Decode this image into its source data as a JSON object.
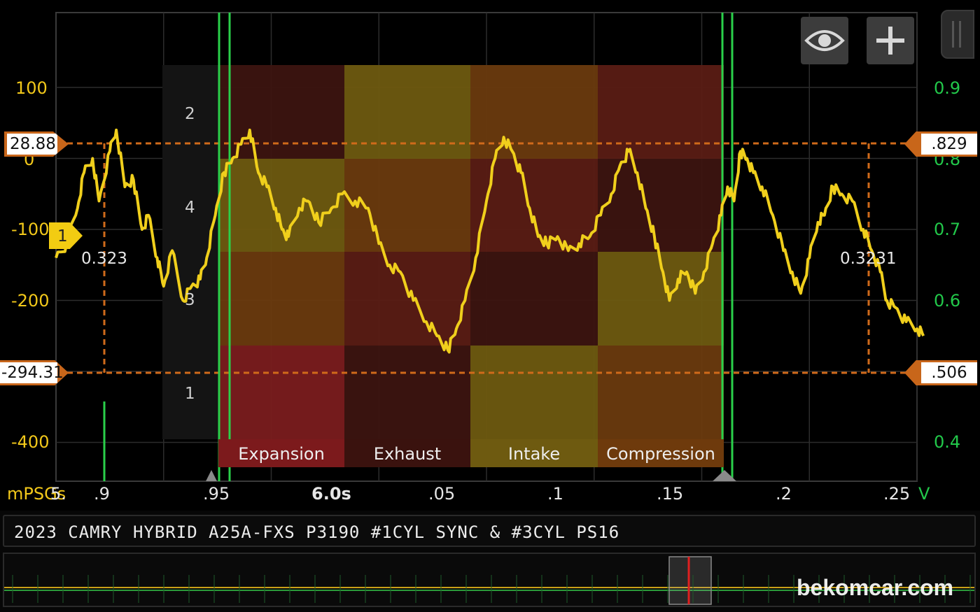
{
  "left_axis": {
    "unit": "mPSGs",
    "ticks": [
      {
        "label": "100",
        "value": 100
      },
      {
        "label": "0",
        "value": 0
      },
      {
        "label": "-100",
        "value": -100
      },
      {
        "label": "-200",
        "value": -200
      },
      {
        "label": "-400",
        "value": -400
      }
    ]
  },
  "right_axis": {
    "unit": "V",
    "ticks": [
      {
        "label": "0.9",
        "value": 0.9
      },
      {
        "label": "0.8",
        "value": 0.8
      },
      {
        "label": "0.7",
        "value": 0.7
      },
      {
        "label": "0.6",
        "value": 0.6
      },
      {
        "label": "0.4",
        "value": 0.4
      }
    ]
  },
  "x_axis": {
    "ticks": [
      {
        "label": "5.",
        "value": 5.85
      },
      {
        "label": ".9",
        "value": 5.9
      },
      {
        "label": ".95",
        "value": 5.95
      },
      {
        "label": "6.0s",
        "value": 6.0
      },
      {
        "label": ".05",
        "value": 6.05
      },
      {
        "label": ".1",
        "value": 6.1
      },
      {
        "label": ".15",
        "value": 6.15
      },
      {
        "label": ".2",
        "value": 6.2
      },
      {
        "label": ".25",
        "value": 6.25
      }
    ]
  },
  "cursors": {
    "left_upper": "28.88",
    "left_lower": "-294.31",
    "right_upper": ".829",
    "right_lower": ".506",
    "period_left": "0.323",
    "period_right": "0.3231"
  },
  "channel_marker": "1",
  "cylinder_labels": [
    "2",
    "4",
    "3",
    "1"
  ],
  "strokes": [
    "Expansion",
    "Exhaust",
    "Intake",
    "Compression"
  ],
  "colors": {
    "trace": "#f0cf1c",
    "sync": "#2ad04a",
    "cursor": "#d06a1a",
    "stroke_red": "#7c1a1c",
    "stroke_darkred": "#3a120e",
    "stroke_olive": "#6e5a10",
    "stroke_orange": "#6e3a0c"
  },
  "toolbar": {
    "view_icon": "eye-icon",
    "add_icon": "plus-icon"
  },
  "title": "2023 CAMRY HYBRID A25A-FXS P3190 #1CYL SYNC & #3CYL PS16",
  "watermark": "bekomcar.com",
  "chart_data": {
    "type": "line",
    "x_range": [
      5.85,
      6.25
    ],
    "ylim_left": [
      -480,
      150
    ],
    "ylim_right": [
      0.32,
      0.95
    ],
    "series": [
      {
        "axis": "right",
        "x": [
          5.85,
          5.855,
          5.86,
          5.863,
          5.867,
          5.87,
          5.875,
          5.878,
          5.882,
          5.886,
          5.89,
          5.893,
          5.897,
          5.9,
          5.904,
          5.909,
          5.913,
          5.917,
          5.92,
          5.924,
          5.928,
          5.932,
          5.936,
          5.94,
          5.944,
          5.948,
          5.952,
          5.955,
          5.958,
          5.963,
          5.967,
          5.972,
          5.978,
          5.983,
          5.989,
          5.995,
          6.0,
          6.005,
          6.01,
          6.016,
          6.022,
          6.027,
          6.032,
          6.036,
          6.04,
          6.045,
          6.05,
          6.054,
          6.058,
          6.062,
          6.066,
          6.07,
          6.074,
          6.078,
          6.083,
          6.088,
          6.093,
          6.098,
          6.103,
          6.108,
          6.112,
          6.116,
          6.12,
          6.124,
          6.128,
          6.132,
          6.135,
          6.139,
          6.143,
          6.147,
          6.151,
          6.155,
          6.159,
          6.162,
          6.165,
          6.168,
          6.171,
          6.174,
          6.178,
          6.183,
          6.188,
          6.192,
          6.196,
          6.2,
          6.204,
          6.207,
          6.211,
          6.215,
          6.22,
          6.225,
          6.229,
          6.233,
          6.236,
          6.24,
          6.245,
          6.25,
          6.253
        ],
        "y": [
          0.66,
          0.68,
          0.73,
          0.78,
          0.8,
          0.74,
          0.81,
          0.84,
          0.76,
          0.77,
          0.7,
          0.72,
          0.66,
          0.62,
          0.67,
          0.6,
          0.62,
          0.63,
          0.66,
          0.72,
          0.78,
          0.8,
          0.82,
          0.84,
          0.78,
          0.76,
          0.73,
          0.7,
          0.69,
          0.73,
          0.74,
          0.71,
          0.73,
          0.75,
          0.74,
          0.73,
          0.68,
          0.65,
          0.64,
          0.6,
          0.57,
          0.55,
          0.53,
          0.56,
          0.6,
          0.66,
          0.74,
          0.8,
          0.83,
          0.81,
          0.78,
          0.73,
          0.69,
          0.68,
          0.69,
          0.67,
          0.68,
          0.69,
          0.72,
          0.75,
          0.79,
          0.81,
          0.78,
          0.73,
          0.69,
          0.64,
          0.6,
          0.63,
          0.64,
          0.61,
          0.64,
          0.68,
          0.72,
          0.76,
          0.74,
          0.81,
          0.8,
          0.78,
          0.76,
          0.72,
          0.67,
          0.64,
          0.61,
          0.66,
          0.71,
          0.72,
          0.76,
          0.75,
          0.74,
          0.7,
          0.67,
          0.64,
          0.6,
          0.59,
          0.57,
          0.56,
          0.55
        ]
      }
    ]
  }
}
